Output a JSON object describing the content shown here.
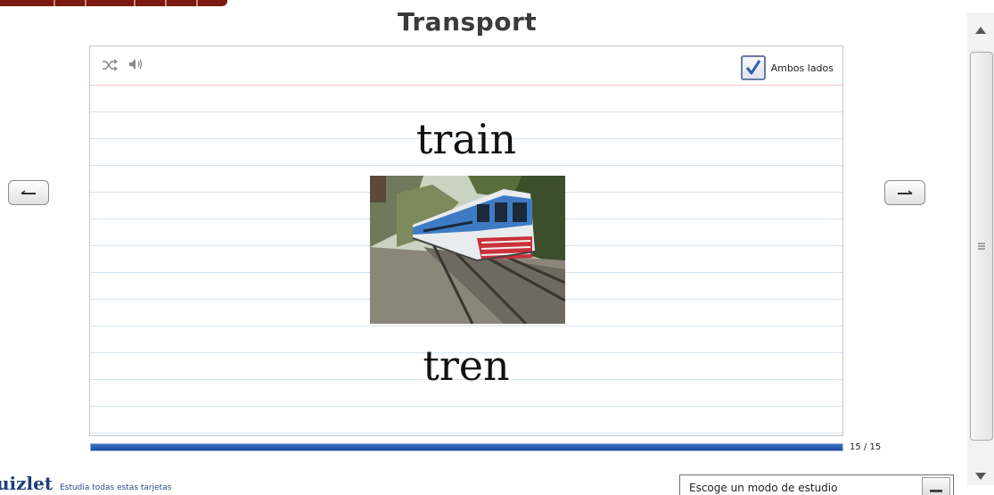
{
  "deck": {
    "title": "Transport"
  },
  "card": {
    "term": "train",
    "definition": "tren",
    "image": "train-photo",
    "toolbar": {
      "shuffle_icon": "shuffle-icon",
      "sound_icon": "speaker-icon",
      "both_sides_label": "Ambos lados",
      "both_sides_checked": true
    }
  },
  "progress": {
    "current": 15,
    "total": 15,
    "fraction": 1.0,
    "label": "15 / 15"
  },
  "navigation": {
    "prev_icon": "arrow-left-icon",
    "next_icon": "arrow-right-icon"
  },
  "footer": {
    "brand": "uizlet",
    "study_link": "Estudia todas estas tarjetas",
    "mode_select_value": "Escoge un modo de estudio"
  },
  "colors": {
    "title": "#3a3a3a",
    "progress_fill": "#1c4f9f",
    "brand": "#1d3e7a",
    "top_strip": "#7a1a10"
  }
}
